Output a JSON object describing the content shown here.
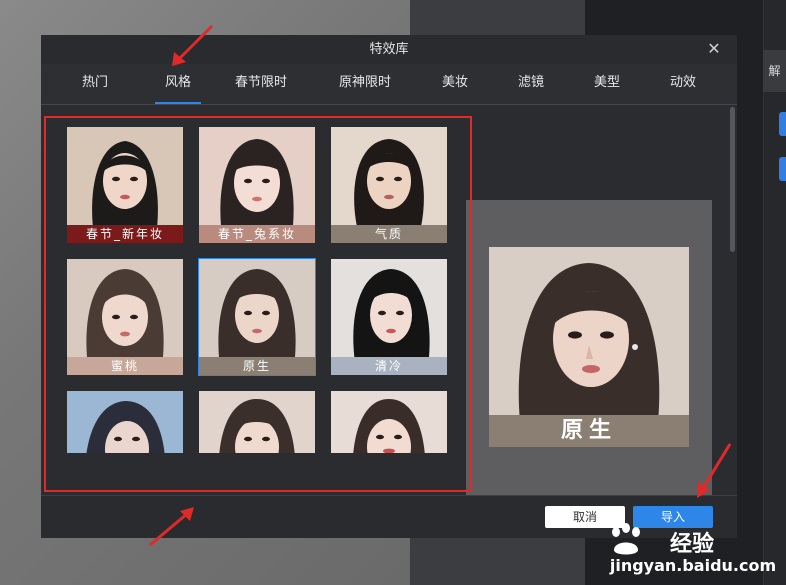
{
  "dialog": {
    "title": "特效库",
    "close_icon": "close-icon"
  },
  "tabs": [
    {
      "label": "热门",
      "active": false
    },
    {
      "label": "风格",
      "active": true
    },
    {
      "label": "春节限时",
      "active": false
    },
    {
      "label": "原神限时",
      "active": false
    },
    {
      "label": "美妆",
      "active": false
    },
    {
      "label": "滤镜",
      "active": false
    },
    {
      "label": "美型",
      "active": false
    },
    {
      "label": "动效",
      "active": false
    }
  ],
  "effects": [
    {
      "label": "春节_新年妆",
      "label_color": "#7a1a1a"
    },
    {
      "label": "春节_兔系妆",
      "label_color": "#b98a7e"
    },
    {
      "label": "气质",
      "label_color": "#8b7f74"
    },
    {
      "label": "蜜桃",
      "label_color": "#c7a79a"
    },
    {
      "label": "原生",
      "label_color": "#8b7f74",
      "selected": true
    },
    {
      "label": "清冷",
      "label_color": "#a9b2c0"
    },
    {
      "label": ""
    },
    {
      "label": ""
    },
    {
      "label": ""
    }
  ],
  "preview": {
    "label": "原生"
  },
  "footer": {
    "cancel_label": "取消",
    "import_label": "导入"
  },
  "background_app": {
    "side_tab_label": "解"
  },
  "watermark": {
    "text": "jingyan.baidu.com",
    "brand": "经验"
  },
  "colors": {
    "accent": "#2f86e9",
    "annotation_red": "#e02a2a"
  }
}
